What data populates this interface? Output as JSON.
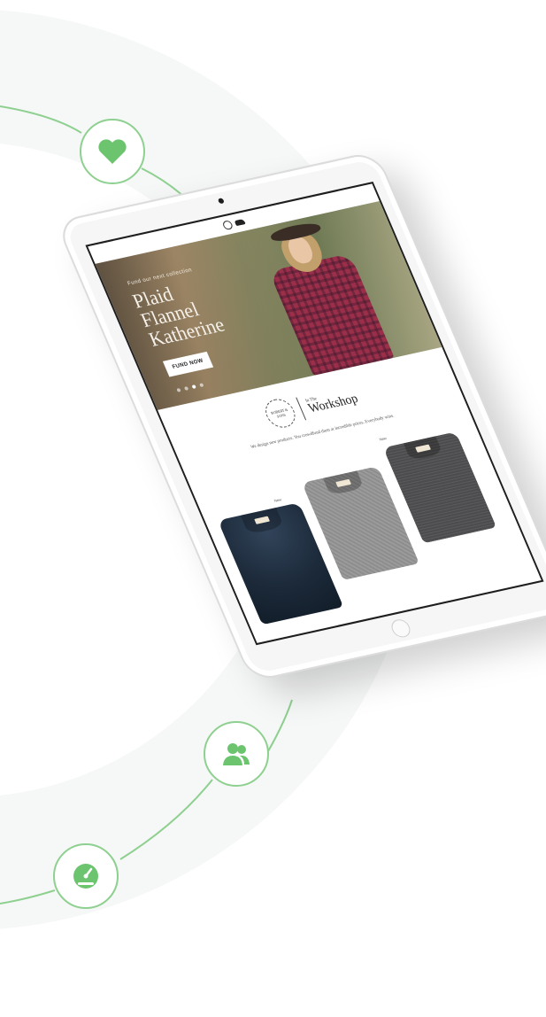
{
  "hero": {
    "eyebrow": "Fund our next collection",
    "title": "Plaid\nFlannel\nKatherine",
    "cta_label": "FUND NOW",
    "slide_count": 4,
    "active_slide": 3
  },
  "workshop": {
    "badge_text": "ROBERT & SONS",
    "eyebrow": "In The",
    "title": "Workshop",
    "description": "We design new products. You crowdfund them at incredible prices. Everybody wins."
  },
  "products": [
    {
      "label": "New",
      "name": "navy-shirt"
    },
    {
      "label": "",
      "name": "grey-shirt"
    },
    {
      "label": "New",
      "name": "charcoal-shirt"
    }
  ],
  "feature_icons": [
    "heart-icon",
    "users-icon",
    "speedometer-icon"
  ],
  "colors": {
    "accent_green": "#6cc46e",
    "line_green": "#8ed08f",
    "background_ring": "#f6f7f7"
  }
}
